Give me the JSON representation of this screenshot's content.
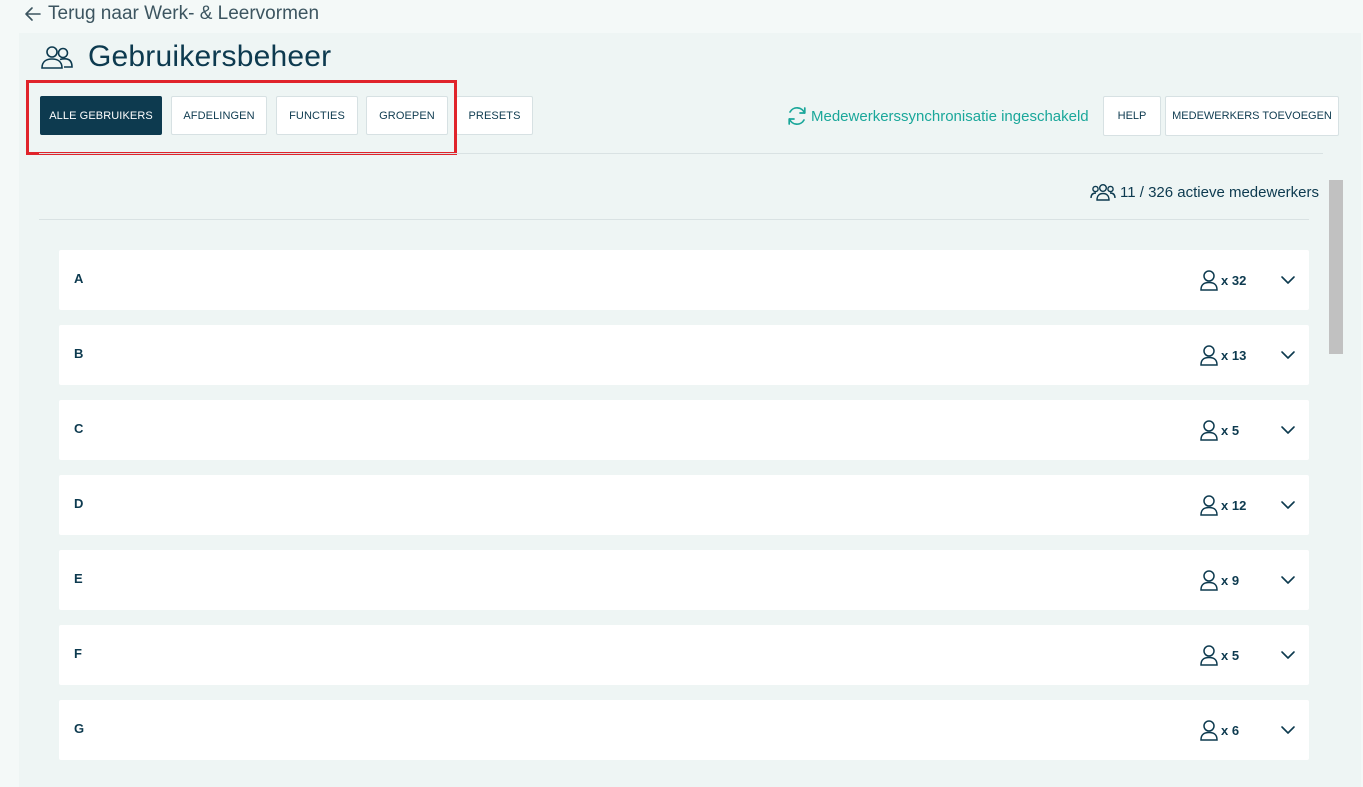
{
  "back_link": {
    "label": "Terug naar Werk- & Leervormen"
  },
  "header": {
    "title": "Gebruikersbeheer"
  },
  "tabs": [
    {
      "label": "ALLE GEBRUIKERS",
      "active": true
    },
    {
      "label": "AFDELINGEN",
      "active": false
    },
    {
      "label": "FUNCTIES",
      "active": false
    },
    {
      "label": "GROEPEN",
      "active": false
    },
    {
      "label": "PRESETS",
      "active": false
    }
  ],
  "sync": {
    "label": "Medewerkerssynchronisatie ingeschakeld"
  },
  "actions": {
    "help_label": "HELP",
    "add_label": "MEDEWERKERS TOEVOEGEN"
  },
  "summary": {
    "active_text": "11 / 326 actieve medewerkers"
  },
  "groups": [
    {
      "letter": "A",
      "count": "x 32"
    },
    {
      "letter": "B",
      "count": "x 13"
    },
    {
      "letter": "C",
      "count": "x 5"
    },
    {
      "letter": "D",
      "count": "x 12"
    },
    {
      "letter": "E",
      "count": "x 9"
    },
    {
      "letter": "F",
      "count": "x 5"
    },
    {
      "letter": "G",
      "count": "x 6"
    }
  ],
  "colors": {
    "primary": "#0d3a4f",
    "accent": "#1aa79a",
    "highlight": "#e0242b",
    "background": "#eef5f4"
  }
}
